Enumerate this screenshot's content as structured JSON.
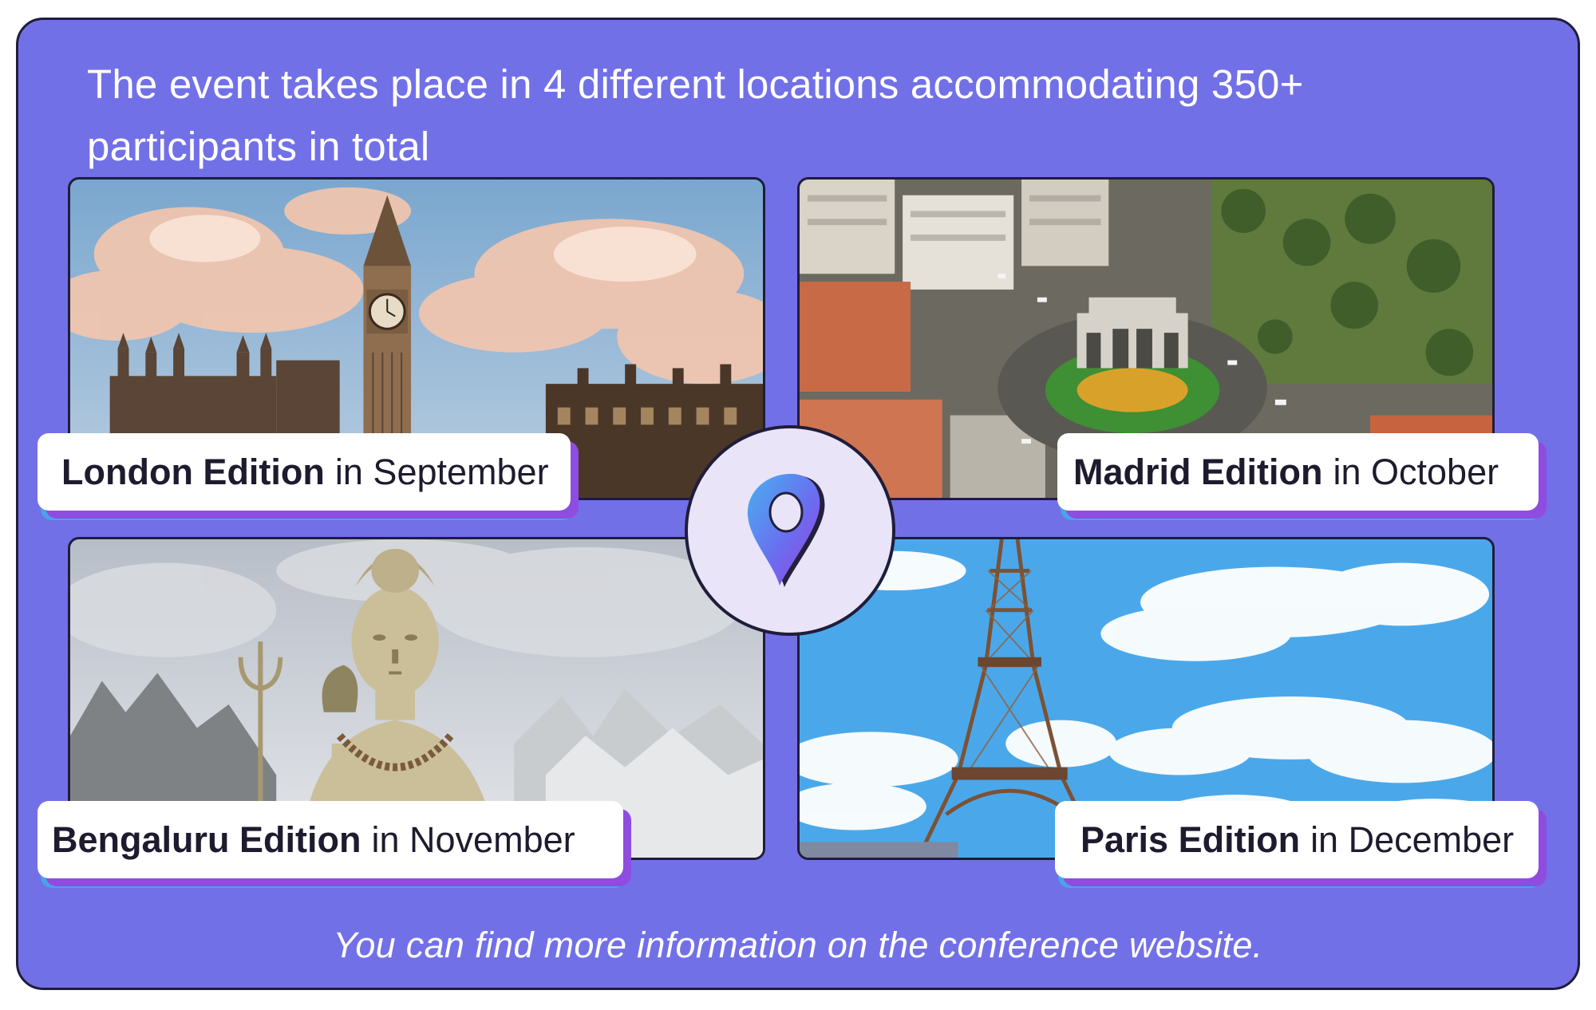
{
  "headline": "The event takes place in 4 different locations accommodating 350+ participants in total",
  "editions": [
    {
      "city_label": "London Edition",
      "month_label": "in September",
      "image": "big-ben-westminster-photo"
    },
    {
      "city_label": "Madrid Edition",
      "month_label": "in October",
      "image": "puerta-de-alcala-aerial-photo"
    },
    {
      "city_label": "Bengaluru Edition",
      "month_label": "in November",
      "image": "shiva-statue-photo"
    },
    {
      "city_label": "Paris Edition",
      "month_label": "in December",
      "image": "eiffel-tower-photo"
    }
  ],
  "center_icon": "location-pin-icon",
  "footer": "You can find more information on the conference website.",
  "colors": {
    "background": "#7270e7",
    "border": "#1f1d3a",
    "label_shadow_purple": "#8f4ce0",
    "label_shadow_blue": "#4aa3e8",
    "pin_circle": "#e9e4f7"
  }
}
